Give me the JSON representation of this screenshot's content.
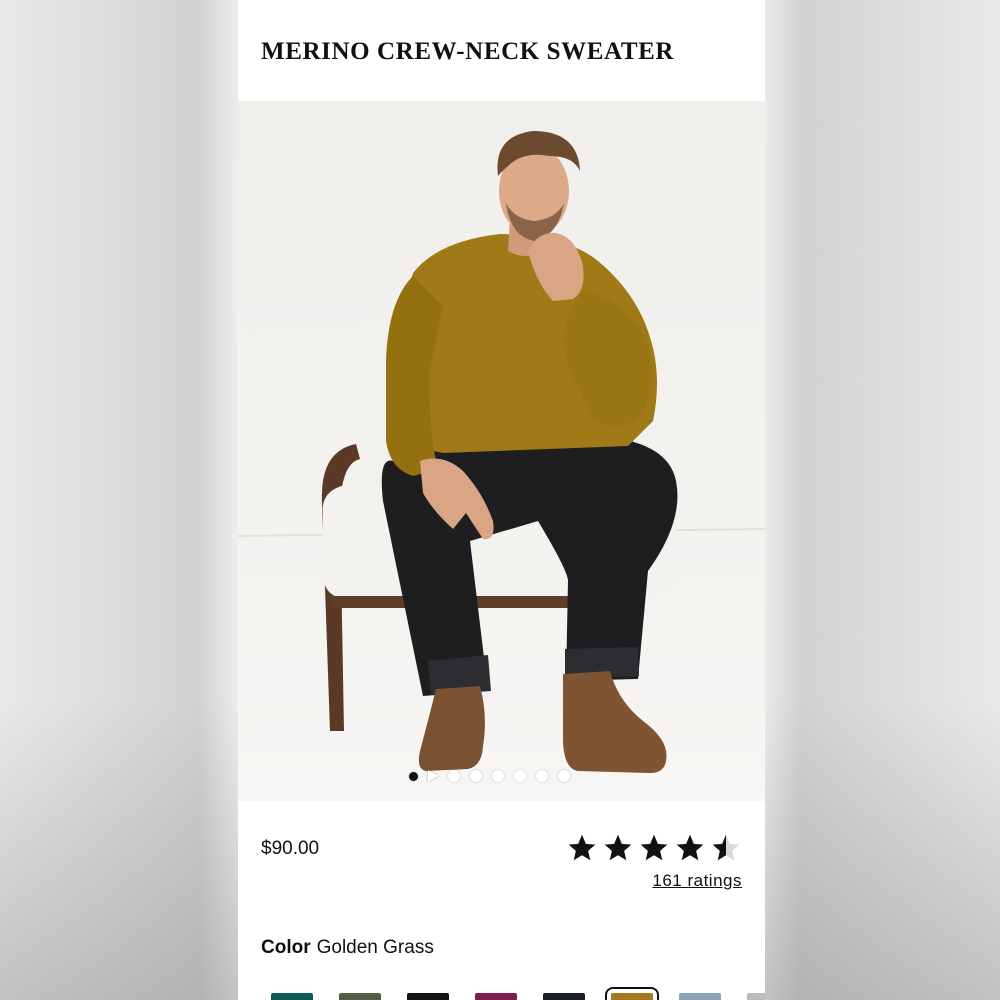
{
  "product": {
    "title": "MERINO CREW-NECK SWEATER",
    "price": "$90.00",
    "rating": {
      "value": 4.5,
      "max": 5,
      "count_label": "161 ratings"
    },
    "color": {
      "label": "Color",
      "selected_name": "Golden Grass"
    }
  },
  "gallery": {
    "image_alt": "Man in mustard merino crew-neck sweater sitting on a white armchair",
    "total_images": 8,
    "current_index": 1,
    "has_video": true
  },
  "swatches": [
    {
      "color": "#0f5a55",
      "selected": false
    },
    {
      "color": "#555d48",
      "selected": false
    },
    {
      "color": "#141414",
      "selected": false
    },
    {
      "color": "#7d1e4c",
      "selected": false
    },
    {
      "color": "#1c1f29",
      "selected": false
    },
    {
      "color": "#a37a1c",
      "selected": true
    },
    {
      "color": "#8ea2bb",
      "selected": false
    },
    {
      "color": "#bcbcbc",
      "selected": false
    }
  ],
  "colors": {
    "sweater": "#a07a17",
    "jeans": "#1e1e21",
    "boots": "#7b5231",
    "chair": "#f2f0ec",
    "chair_wood": "#5a3a26",
    "skin": "#d9a584",
    "hair": "#6b4a30"
  }
}
